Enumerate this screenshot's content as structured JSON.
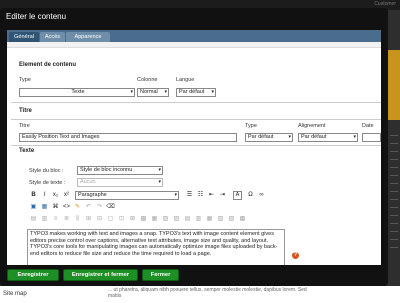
{
  "background": {
    "top_right_label": "Customer",
    "sitemap_label": "Site map",
    "snippet": "... ut pharetra, aliquam nibh posuere tellus, semper molestie molestie, dapibus lorem. Sed mattis"
  },
  "dialog": {
    "title": "Editer le contenu",
    "tabs": [
      {
        "label": "Général",
        "active": true
      },
      {
        "label": "Accès",
        "active": false
      },
      {
        "label": "Apparence",
        "active": false
      }
    ]
  },
  "element_section": {
    "title": "Element de contenu",
    "type_label": "Type",
    "type_value": "Texte",
    "colonne_label": "Colonne",
    "colonne_value": "Normal",
    "langue_label": "Langue",
    "langue_value": "Par défaut"
  },
  "titre_section": {
    "title": "Titre",
    "titre_label": "Titre",
    "titre_value": "Easily Position Text and Images",
    "type_label": "Type",
    "type_value": "Par défaut",
    "alignement_label": "Alignement",
    "alignement_value": "Par défaut",
    "date_label": "Date"
  },
  "texte_section": {
    "title": "Texte",
    "style_bloc_label": "Style du bloc :",
    "style_bloc_value": "Style de bloc inconnu",
    "style_texte_label": "Style de texte :",
    "style_texte_value": "Aucun",
    "paragraph_value": "Paragraphe",
    "body": "TYPO3 makes working with text and images a snap. TYPO3's text with image content element gives editors precise control over captions, alternative text attributes, image size and quality, and layout. TYPO3's core tools for manipulating images can automatically optimize image files uploaded by back-end editors to reduce file size and reduce the time required to load a page."
  },
  "toolbar": {
    "bold": "B",
    "italic": "I",
    "subscript": "x₂",
    "superscript": "x²",
    "text_color": "A",
    "omega": "Ω",
    "link": "∞",
    "source": "<>"
  },
  "footer": {
    "save_label": "Enregistrer",
    "save_close_label": "Enregistrer et fermer",
    "close_label": "Fermer"
  },
  "colors": {
    "save_button": "#1e8f24",
    "tab_active": "#2f5474",
    "tab_bar": "#4a6d8e",
    "help_icon": "#d9541e"
  }
}
